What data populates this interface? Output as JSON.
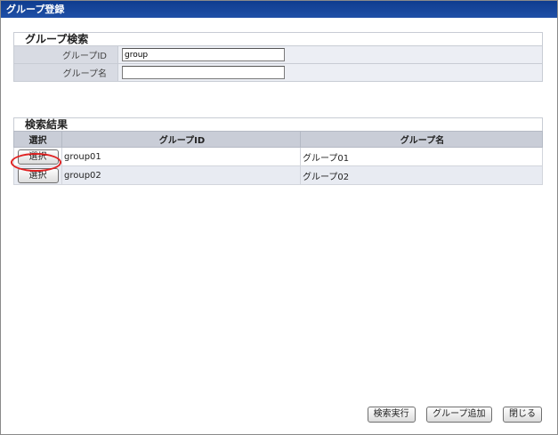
{
  "window": {
    "title": "グループ登録"
  },
  "search": {
    "heading": "グループ検索",
    "group_id_label": "グループID",
    "group_id_value": "group",
    "group_name_label": "グループ名",
    "group_name_value": ""
  },
  "results": {
    "heading": "検索結果",
    "columns": {
      "select": "選択",
      "group_id": "グループID",
      "group_name": "グループ名"
    },
    "rows": [
      {
        "select_label": "選択",
        "group_id": "group01",
        "group_name": "グループ01",
        "highlighted": true
      },
      {
        "select_label": "選択",
        "group_id": "group02",
        "group_name": "グループ02",
        "highlighted": false
      }
    ]
  },
  "footer": {
    "search_button": "検索実行",
    "add_group_button": "グループ追加",
    "close_button": "閉じる"
  },
  "colors": {
    "titlebar": "#1a4a9e",
    "highlight": "#e02020"
  }
}
